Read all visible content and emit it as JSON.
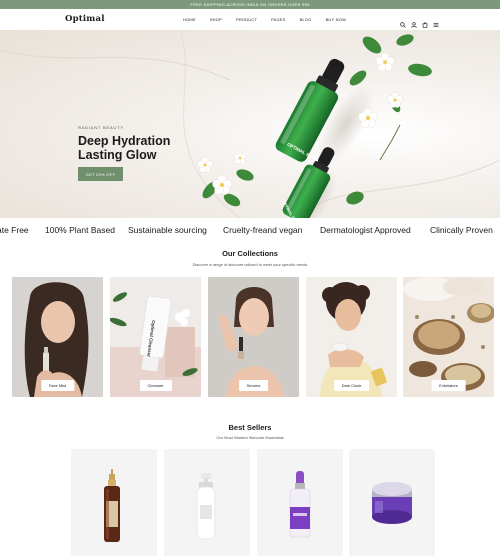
{
  "topbar": {
    "text": "FREE SHIPPING ACROSS INDIA ON ORDERS OVER 999"
  },
  "header": {
    "logo": "Optimal",
    "nav": [
      "HOME",
      "SHOP",
      "PRODUCT",
      "PAGES",
      "BLOG",
      "BUY NOW"
    ],
    "cart_count": "0"
  },
  "hero": {
    "subtitle": "RADIANT BEAUTY",
    "title_line1": "Deep Hydration",
    "title_line2": "Lasting Glow",
    "button": "GET 20% OFF",
    "bottle_label_1": "OPTIMAL SERUM",
    "bottle_label_2": "OPTIMAL SERUM"
  },
  "marquee": [
    "ate Free",
    "100% Plant Based",
    "Sustainable sourcing",
    "Cruelty-freand vegan",
    "Dermatologist Approved",
    "Clinically Proven"
  ],
  "collections": {
    "title": "Our Collections",
    "subtitle": "Discover a range of skincare tailored to meet your specific needs",
    "items": [
      "Face Mist",
      "Cleanser",
      "Serums",
      "Dark Circle",
      "Exfoliators"
    ],
    "tube_label": "Optimal Cleanser"
  },
  "bestsellers": {
    "title": "Best Sellers",
    "subtitle": "Our Most Wanted Skincare Essentials"
  },
  "colors": {
    "accent": "#6f8f6d",
    "topbar": "#7c9a7b",
    "text": "#1b1b1b"
  }
}
